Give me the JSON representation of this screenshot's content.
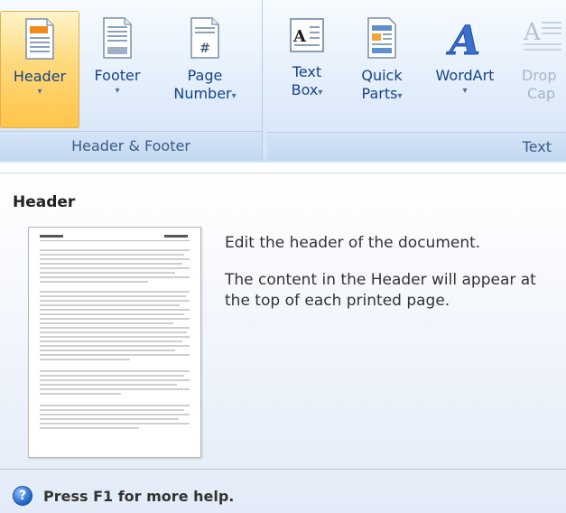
{
  "ribbon": {
    "groups": [
      {
        "label": "Header & Footer",
        "buttons": [
          {
            "label": "Header",
            "icon": "header-icon",
            "active": true
          },
          {
            "label": "Footer",
            "icon": "footer-icon"
          },
          {
            "label_line1": "Page",
            "label_line2": "Number",
            "icon": "page-number-icon"
          }
        ]
      },
      {
        "label": "Text",
        "buttons": [
          {
            "label_line1": "Text",
            "label_line2": "Box",
            "icon": "text-box-icon"
          },
          {
            "label_line1": "Quick",
            "label_line2": "Parts",
            "icon": "quick-parts-icon"
          },
          {
            "label": "WordArt",
            "icon": "wordart-icon"
          },
          {
            "label_line1": "Drop",
            "label_line2": "Cap",
            "icon": "drop-cap-icon",
            "disabled": true
          }
        ]
      }
    ],
    "dropdown_glyph": "▾",
    "page_number_glyph": "#",
    "text_box_glyph": "A",
    "wordart_glyph": "A",
    "drop_cap_glyph": "A"
  },
  "tooltip": {
    "title": "Header",
    "description": "Edit the header of the document.",
    "detail": "The content in the Header will appear at the top of each printed page.",
    "help_icon_glyph": "?",
    "help_text": "Press F1 for more help."
  },
  "colors": {
    "accent": "#15428b",
    "active_button": "#ffd97a",
    "ribbon_bg": "#dbe8f8"
  }
}
